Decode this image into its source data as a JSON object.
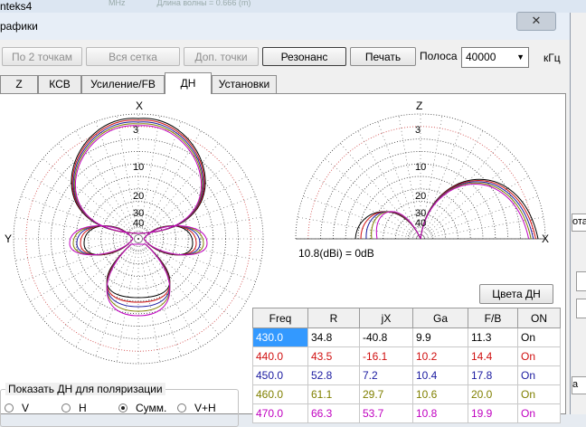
{
  "app": {
    "title": "nteks4",
    "close_glyph": "✕"
  },
  "dialog": {
    "title": "рафики"
  },
  "toolbar": {
    "buttons": [
      {
        "label": "По 2 точкам",
        "enabled": false
      },
      {
        "label": "Вся сетка",
        "enabled": false
      },
      {
        "label": "Доп. точки",
        "enabled": false
      },
      {
        "label": "Резонанс",
        "enabled": true
      },
      {
        "label": "Печать",
        "enabled": true
      }
    ],
    "band_label": "Полоса",
    "band_value": "40000",
    "band_unit": "кГц"
  },
  "tabs": [
    {
      "label": "Z",
      "active": false
    },
    {
      "label": "КСВ",
      "active": false
    },
    {
      "label": "Усиление/FB",
      "active": false
    },
    {
      "label": "ДН",
      "active": true
    },
    {
      "label": "Установки",
      "active": false
    }
  ],
  "polar_left": {
    "top_axis": "X",
    "left_axis": "Y",
    "rings": [
      "3",
      "10",
      "20",
      "30",
      "40"
    ]
  },
  "polar_right": {
    "top_axis": "Z",
    "right_axis": "X",
    "rings": [
      "3",
      "10",
      "20",
      "30",
      "40"
    ],
    "gain_note": "10.8(dBi) = 0dB"
  },
  "colors_button": "Цвета ДН",
  "table": {
    "columns": [
      "Freq",
      "R",
      "jX",
      "Ga",
      "F/B",
      "ON"
    ],
    "rows": [
      {
        "cells": [
          "430.0",
          "34.8",
          "-40.8",
          "9.9",
          "11.3",
          "On"
        ],
        "color": "#000000",
        "selected": true
      },
      {
        "cells": [
          "440.0",
          "43.5",
          "-16.1",
          "10.2",
          "14.4",
          "On"
        ],
        "color": "#d01010",
        "selected": false
      },
      {
        "cells": [
          "450.0",
          "52.8",
          "7.2",
          "10.4",
          "17.8",
          "On"
        ],
        "color": "#1a1aa0",
        "selected": false
      },
      {
        "cells": [
          "460.0",
          "61.1",
          "29.7",
          "10.6",
          "20.0",
          "On"
        ],
        "color": "#808000",
        "selected": false
      },
      {
        "cells": [
          "470.0",
          "66.3",
          "53.7",
          "10.8",
          "19.9",
          "On"
        ],
        "color": "#c000c0",
        "selected": false
      }
    ]
  },
  "polarization": {
    "title": "Показать ДН для поляризации",
    "options": [
      {
        "label": "V",
        "checked": false
      },
      {
        "label": "H",
        "checked": false
      },
      {
        "label": "Сумм.",
        "checked": true
      },
      {
        "label": "V+H",
        "checked": false
      }
    ]
  },
  "background": {
    "header": "Длина волны = 0.666 (m)",
    "fragment": "MHz",
    "side_text": [
      "ота",
      "а за"
    ]
  },
  "pattern_colors": [
    "#000000",
    "#d01010",
    "#1a1aa0",
    "#808000",
    "#c000c0"
  ]
}
